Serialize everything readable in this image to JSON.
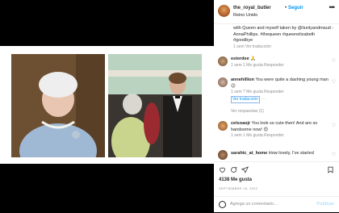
{
  "post": {
    "username": "the_royal_butler",
    "follow_label": "Seguir",
    "location": "Reino Unido",
    "caption": "with Queen and myself taken by @liunlyandmaud - AnnaPhillips. #thequeen #queenelizabeth #goodbye",
    "caption_meta": "1 sem  Ver traducción",
    "likes": "4138 Me gusta",
    "date": "SEPTIEMBRE 16, 2022",
    "add_comment_placeholder": "Agrega un comentario...",
    "publish_label": "Publicar"
  },
  "comments": [
    {
      "user": "esterdee",
      "text": "🙏",
      "meta": "1 sem  1 Me gusta  Responder"
    },
    {
      "user": "annehillion",
      "text": "You were quite a dashing young man 😉",
      "meta": "1 sem  7 Me gusta  Responder",
      "link": "Ver traducción",
      "replies": "Ver respuestas (1)"
    },
    {
      "user": "celsoaojr",
      "text": "You look so cute then! And are so handsome now! 😊",
      "meta": "1 sem  1 Me gusta  Responder"
    },
    {
      "user": "sarahtc_at_home",
      "text": "How lovely, I've started"
    }
  ],
  "icons": [
    "heart-icon",
    "comment-icon",
    "share-icon",
    "bookmark-icon",
    "more-icon",
    "emoji-icon"
  ]
}
